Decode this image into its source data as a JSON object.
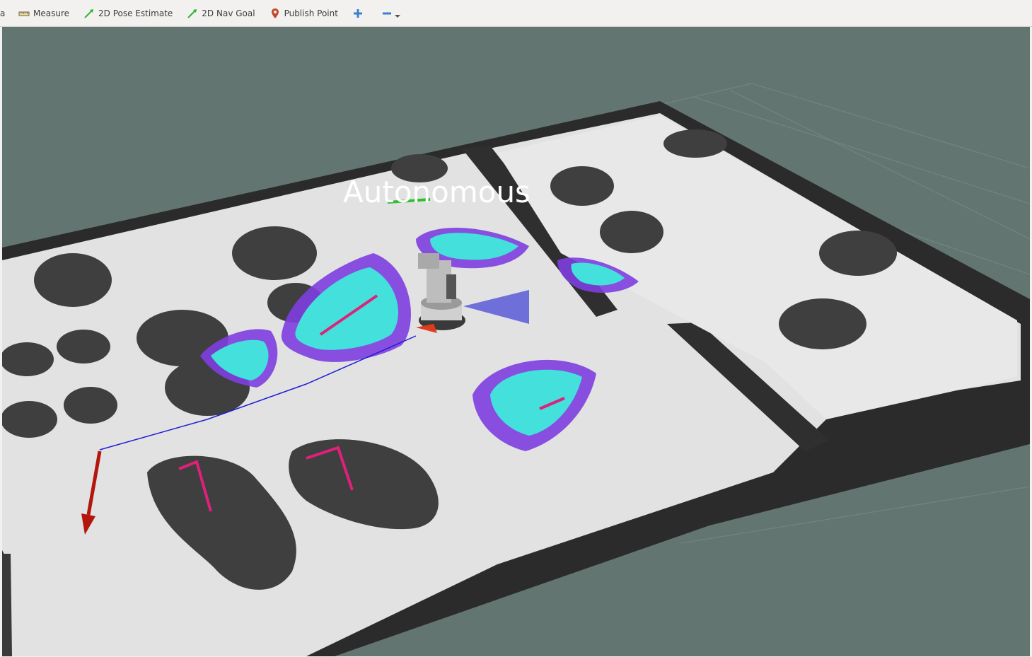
{
  "toolbar": {
    "partial_label": "a",
    "items": [
      {
        "label": "Measure",
        "icon": "ruler-icon"
      },
      {
        "label": "2D Pose Estimate",
        "icon": "green-arrow-icon"
      },
      {
        "label": "2D Nav Goal",
        "icon": "green-arrow-icon"
      },
      {
        "label": "Publish Point",
        "icon": "map-pin-icon"
      }
    ],
    "add_tool_icon": "plus-icon",
    "remove_tool_icon": "minus-icon",
    "menu_icon": "dropdown-arrow-icon"
  },
  "viewport": {
    "overlay_text": "Autonomous",
    "background_color": "#637570",
    "map_free_color": "#e5e5e5",
    "obstacle_color": "#3f3f3f",
    "costmap_colors": [
      "#43e0dc",
      "#c92fd6",
      "#7e3ee0"
    ],
    "goal_arrow_color": "#b3160c",
    "path_color": "#1d1dd6"
  }
}
